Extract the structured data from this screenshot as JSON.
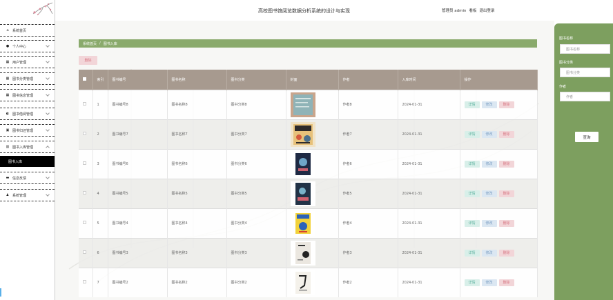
{
  "app": {
    "title": "高校图书馆阅览数据分析系统的设计与实现",
    "user_label": "管理员 admin",
    "dashboard_link": "看板",
    "logout_link": "退出登录"
  },
  "sidebar": {
    "items": [
      {
        "label": "系统首页",
        "icon": "home-icon",
        "glyph": "⌂",
        "chevron": false
      },
      {
        "label": "个人中心",
        "icon": "user-icon",
        "glyph": "●",
        "chevron": true
      },
      {
        "label": "用户管理",
        "icon": "grid-icon",
        "glyph": "▦",
        "chevron": true
      },
      {
        "label": "图书分类管理",
        "icon": "grid-icon",
        "glyph": "▦",
        "chevron": true
      },
      {
        "label": "图书信息管理",
        "icon": "grid-icon",
        "glyph": "▦",
        "chevron": true
      },
      {
        "label": "图书借阅管理",
        "icon": "chart-icon",
        "glyph": "◐",
        "chevron": true
      },
      {
        "label": "图书归还管理",
        "icon": "book-icon",
        "glyph": "▣",
        "chevron": true
      },
      {
        "label": "图书入库管理",
        "icon": "bar-chart-icon",
        "glyph": "▥",
        "chevron": true
      },
      {
        "label": "信息反馈",
        "icon": "message-icon",
        "glyph": "▬",
        "chevron": true
      },
      {
        "label": "系统管理",
        "icon": "person-icon",
        "glyph": "♟",
        "chevron": true
      }
    ],
    "active_sub": "图书入库"
  },
  "breadcrumb": {
    "home": "系统首页",
    "sep": "/",
    "current": "图书入库"
  },
  "toolbar": {
    "delete_label": "删除"
  },
  "table": {
    "headers": [
      "",
      "索引",
      "图书编号",
      "图书名称",
      "图书分类",
      "封面",
      "作者",
      "入库时间",
      "操作"
    ],
    "actions": {
      "detail": "详情",
      "edit": "修改",
      "delete": "删除"
    },
    "rows": [
      {
        "idx": "1",
        "code": "图书编号8",
        "name": "图书名称8",
        "cat": "图书分类8",
        "author": "作者8",
        "date": "2024-01-31"
      },
      {
        "idx": "2",
        "code": "图书编号7",
        "name": "图书名称7",
        "cat": "图书分类7",
        "author": "作者7",
        "date": "2024-01-31"
      },
      {
        "idx": "3",
        "code": "图书编号6",
        "name": "图书名称6",
        "cat": "图书分类6",
        "author": "作者6",
        "date": "2024-01-31"
      },
      {
        "idx": "4",
        "code": "图书编号5",
        "name": "图书名称5",
        "cat": "图书分类5",
        "author": "作者5",
        "date": "2024-01-31"
      },
      {
        "idx": "5",
        "code": "图书编号4",
        "name": "图书名称4",
        "cat": "图书分类4",
        "author": "作者4",
        "date": "2024-01-31"
      },
      {
        "idx": "6",
        "code": "图书编号3",
        "name": "图书名称3",
        "cat": "图书分类3",
        "author": "作者3",
        "date": "2024-01-31"
      },
      {
        "idx": "7",
        "code": "图书编号2",
        "name": "图书名称2",
        "cat": "图书分类2",
        "author": "作者2",
        "date": "2024-01-31"
      }
    ]
  },
  "search": {
    "name_label": "图书名称",
    "name_placeholder": "图书名称",
    "cat_label": "图书分类",
    "cat_placeholder": "图书分类",
    "author_label": "作者",
    "author_placeholder": "作者",
    "button": "查询"
  },
  "colors": {
    "accent_green": "#7d9f5f",
    "header_brown": "#a79a8f",
    "sidebar_active": "#000000"
  }
}
